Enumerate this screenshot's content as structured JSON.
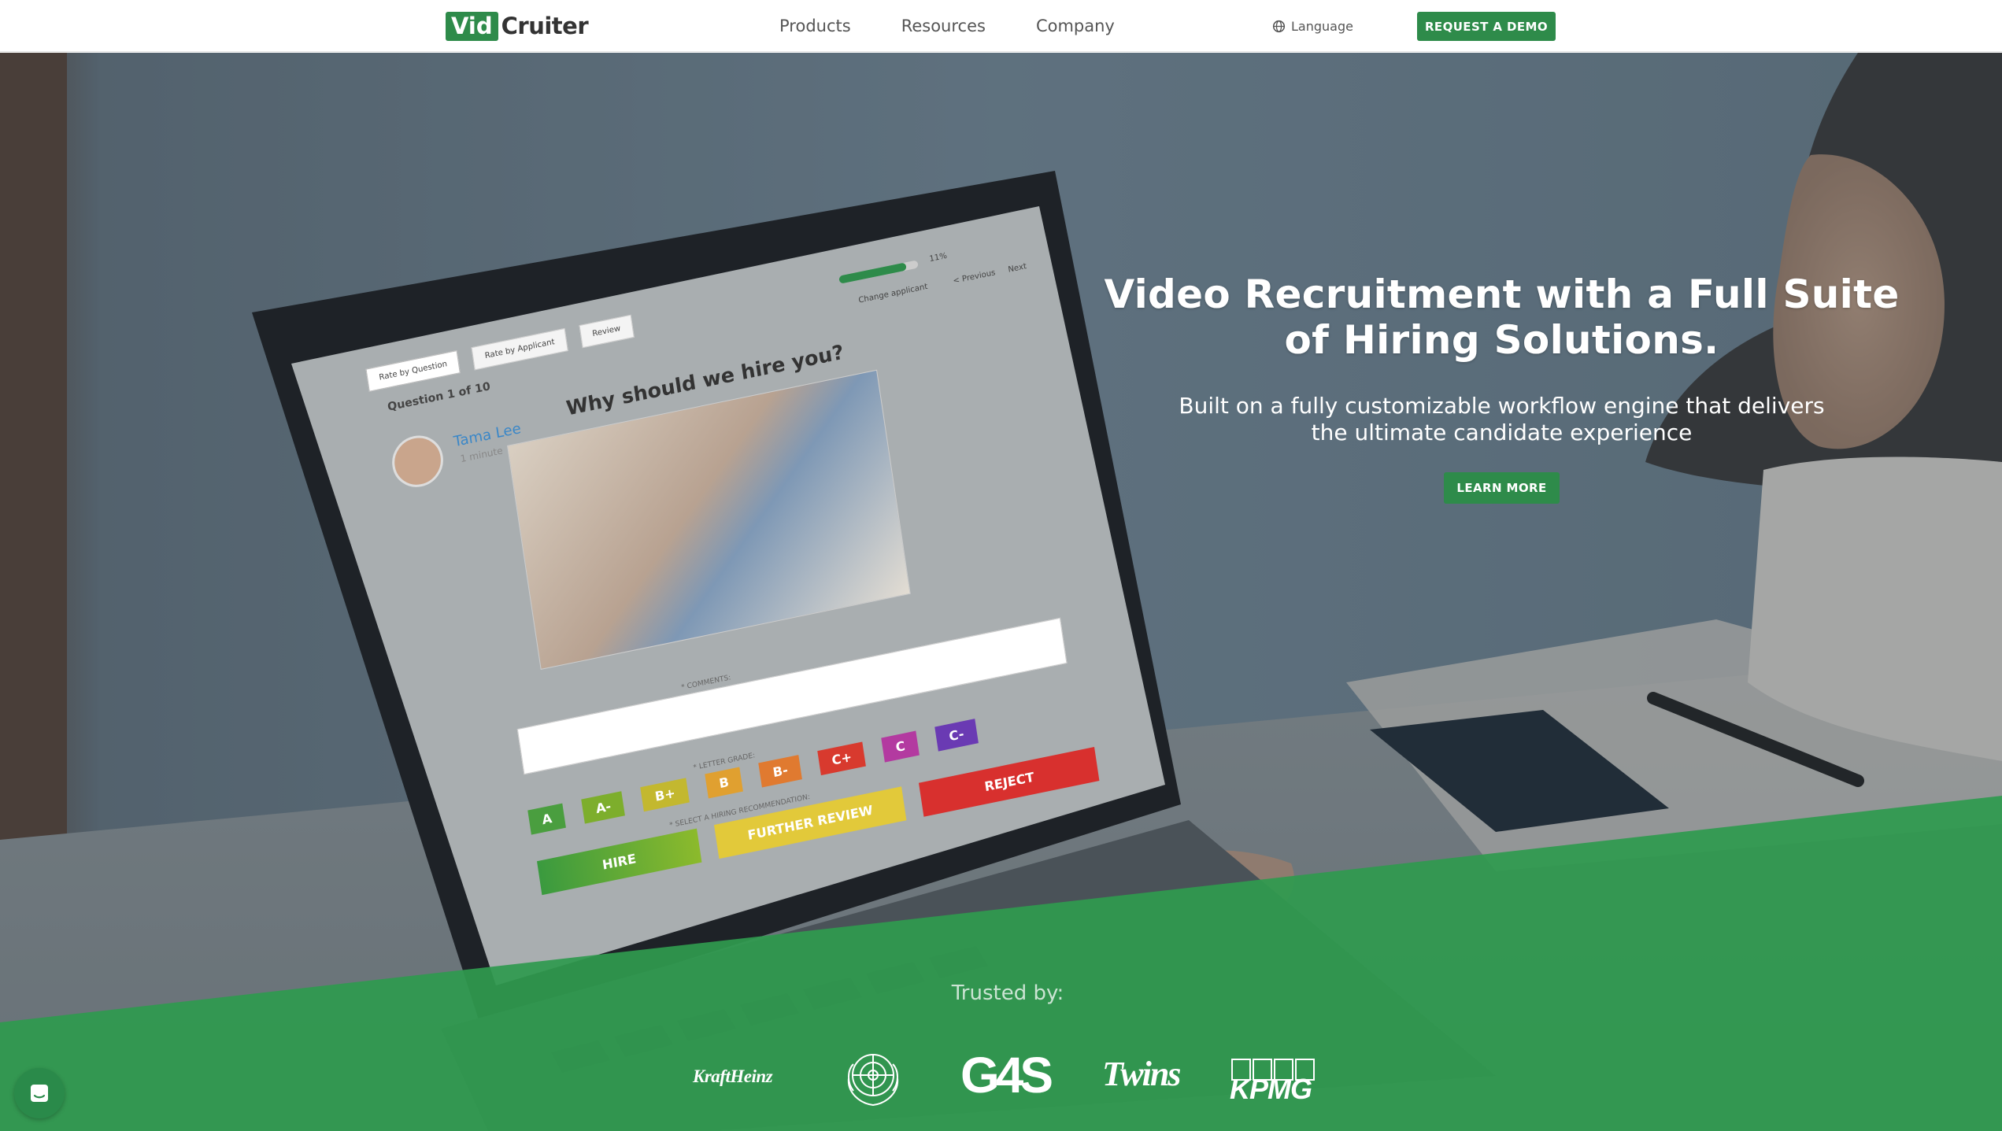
{
  "nav": {
    "logo_vid": "Vid",
    "logo_cruiter": "Cruiter",
    "links": [
      "Products",
      "Resources",
      "Company"
    ],
    "language": "Language",
    "demo_button": "REQUEST A DEMO"
  },
  "hero": {
    "title": "Video Recruitment with a Full Suite of Hiring Solutions.",
    "subtitle": "Built on a fully customizable workflow engine that delivers the ultimate candidate experience",
    "learn_more": "LEARN MORE"
  },
  "screen": {
    "tabs": [
      "Rate by Question",
      "Rate by Applicant",
      "Review"
    ],
    "progress_label": "11%",
    "change_applicant": "Change applicant",
    "previous": "< Previous",
    "next": "Next",
    "question_counter": "Question 1 of 10",
    "candidate_name": "Tama Lee",
    "duration": "1 minute",
    "question": "Why should we hire you?",
    "comments_label": "* COMMENTS:",
    "letter_grade_label": "* LETTER GRADE:",
    "recommendation_label": "* SELECT A HIRING RECOMMENDATION:",
    "grades": [
      "A",
      "A-",
      "B+",
      "B",
      "B-",
      "C+",
      "C",
      "C-"
    ],
    "recommendations": [
      "HIRE",
      "FURTHER REVIEW",
      "REJECT"
    ]
  },
  "trusted": {
    "label": "Trusted by:",
    "clients": [
      "KraftHeinz",
      "UN",
      "G4S",
      "Twins",
      "KPMG"
    ]
  },
  "colors": {
    "brand_green": "#2e8b4a",
    "band_green": "#2f9a4f"
  }
}
